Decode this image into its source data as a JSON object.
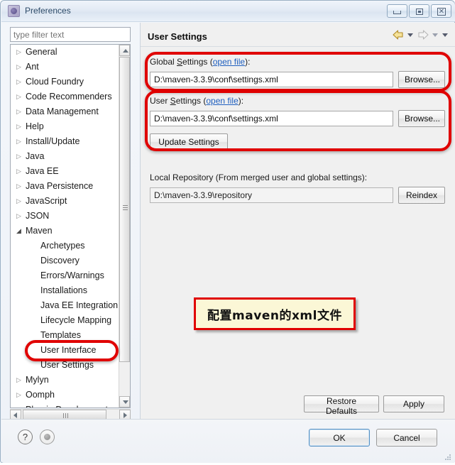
{
  "window": {
    "title": "Preferences",
    "icon": "preferences-icon",
    "controls": {
      "minimize": "minimize-icon",
      "maximize": "maximize-icon",
      "close": "close-icon"
    }
  },
  "filter": {
    "placeholder": "type filter text",
    "value": ""
  },
  "tree": {
    "items": [
      {
        "label": "General",
        "arrow": "▷",
        "level": 0,
        "expandable": true
      },
      {
        "label": "Ant",
        "arrow": "▷",
        "level": 0,
        "expandable": true
      },
      {
        "label": "Cloud Foundry",
        "arrow": "▷",
        "level": 0,
        "expandable": true
      },
      {
        "label": "Code Recommenders",
        "arrow": "▷",
        "level": 0,
        "expandable": true
      },
      {
        "label": "Data Management",
        "arrow": "▷",
        "level": 0,
        "expandable": true
      },
      {
        "label": "Help",
        "arrow": "▷",
        "level": 0,
        "expandable": true
      },
      {
        "label": "Install/Update",
        "arrow": "▷",
        "level": 0,
        "expandable": true
      },
      {
        "label": "Java",
        "arrow": "▷",
        "level": 0,
        "expandable": true
      },
      {
        "label": "Java EE",
        "arrow": "▷",
        "level": 0,
        "expandable": true
      },
      {
        "label": "Java Persistence",
        "arrow": "▷",
        "level": 0,
        "expandable": true
      },
      {
        "label": "JavaScript",
        "arrow": "▷",
        "level": 0,
        "expandable": true
      },
      {
        "label": "JSON",
        "arrow": "▷",
        "level": 0,
        "expandable": true
      },
      {
        "label": "Maven",
        "arrow": "◢",
        "level": 0,
        "expandable": true,
        "expanded": true
      },
      {
        "label": "Archetypes",
        "arrow": "",
        "level": 1
      },
      {
        "label": "Discovery",
        "arrow": "",
        "level": 1
      },
      {
        "label": "Errors/Warnings",
        "arrow": "",
        "level": 1
      },
      {
        "label": "Installations",
        "arrow": "",
        "level": 1
      },
      {
        "label": "Java EE Integration",
        "arrow": "",
        "level": 1
      },
      {
        "label": "Lifecycle Mapping",
        "arrow": "",
        "level": 1
      },
      {
        "label": "Templates",
        "arrow": "",
        "level": 1
      },
      {
        "label": "User Interface",
        "arrow": "",
        "level": 1
      },
      {
        "label": "User Settings",
        "arrow": "",
        "level": 1,
        "selected": true
      },
      {
        "label": "Mylyn",
        "arrow": "▷",
        "level": 0,
        "expandable": true
      },
      {
        "label": "Oomph",
        "arrow": "▷",
        "level": 0,
        "expandable": true
      },
      {
        "label": "Plug-in Development",
        "arrow": "▷",
        "level": 0,
        "expandable": true
      }
    ]
  },
  "page": {
    "title": "User Settings",
    "nav": {
      "back": "back-arrow-icon",
      "back_menu": "chevron-down-icon",
      "forward": "forward-arrow-icon",
      "forward_menu": "chevron-down-icon",
      "view_menu": "chevron-down-icon"
    },
    "global_settings": {
      "label_prefix": "Global ",
      "label_mnemonic": "S",
      "label_rest": "ettings (",
      "link": "open file",
      "label_suffix": "):",
      "value": "D:\\maven-3.3.9\\conf\\settings.xml",
      "browse_label": "Browse..."
    },
    "user_settings": {
      "label_prefix": "User ",
      "label_mnemonic": "S",
      "label_rest": "ettings (",
      "link": "open file",
      "label_suffix": "):",
      "value": "D:\\maven-3.3.9\\conf\\settings.xml",
      "browse_label": "Browse...",
      "update_label": "Update Settings"
    },
    "local_repository": {
      "label": "Local Repository (From merged user and global settings):",
      "value": "D:\\maven-3.3.9\\repository",
      "reindex_label": "Reindex"
    },
    "restore_defaults_label": "Restore Defaults",
    "apply_label": "Apply"
  },
  "annotation": {
    "note_text": "配置maven的xml文件",
    "highlight_color": "#e00000",
    "note_background": "#fbf7d6"
  },
  "footer": {
    "help_icon": "question-mark-icon",
    "record_icon": "record-icon",
    "ok_label": "OK",
    "cancel_label": "Cancel"
  }
}
